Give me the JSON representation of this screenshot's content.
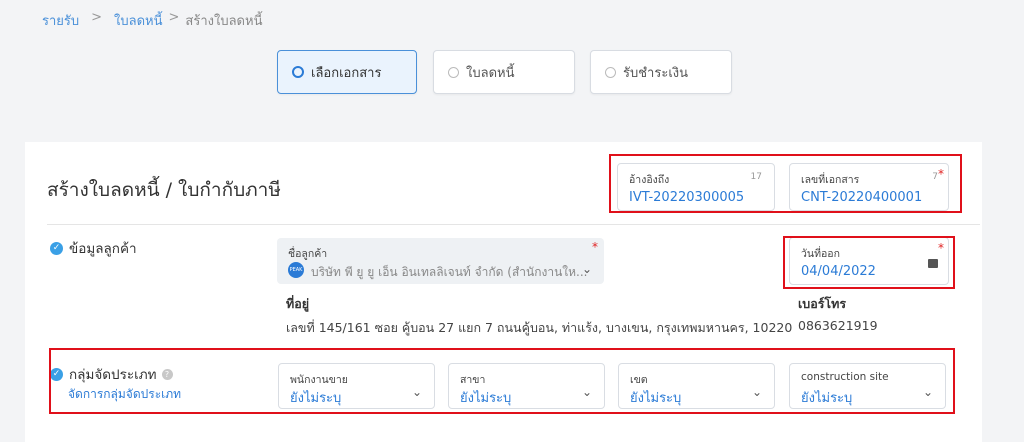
{
  "breadcrumb": {
    "root": "รายรับ",
    "sep1": ">",
    "section": "ใบลดหนี้",
    "sep2": ">",
    "current": "สร้างใบลดหนี้"
  },
  "steps": [
    {
      "label": "เลือกเอกสาร",
      "active": true
    },
    {
      "label": "ใบลดหนี้",
      "active": false
    },
    {
      "label": "รับชำระเงิน",
      "active": false
    }
  ],
  "header": {
    "title": "สร้างใบลดหนี้ / ใบกำกับภาษี"
  },
  "reference": {
    "label": "อ้างอิงถึง",
    "value": "IVT-20220300005",
    "count": "17"
  },
  "doc_number": {
    "label": "เลขที่เอกสาร",
    "value": "CNT-20220400001",
    "count": "7",
    "required": "*"
  },
  "customer_section": {
    "label": "ข้อมูลลูกค้า"
  },
  "customer": {
    "label": "ชื่อลูกค้า",
    "required": "*",
    "avatar_text": "PEAK",
    "value": "บริษัท พี ยู ยู เอ็น อินเทลลิเจนท์ จำกัด (สำนักงานให...",
    "address_label": "ที่อยู่",
    "address": "เลขที่ 145/161 ซอย คู้บอน 27 แยก 7 ถนนคู้บอน, ท่าแร้ง, บางเขน, กรุงเทพมหานคร, 10220",
    "phone_label": "เบอร์โทร",
    "phone": "0863621919"
  },
  "issue_date": {
    "label": "วันที่ออก",
    "value": "04/04/2022",
    "required": "*"
  },
  "category_section": {
    "label": "กลุ่มจัดประเภท",
    "help": "?",
    "manage_link": "จัดการกลุ่มจัดประเภท"
  },
  "category_fields": [
    {
      "label": "พนักงานขาย",
      "value": "ยังไม่ระบุ"
    },
    {
      "label": "สาขา",
      "value": "ยังไม่ระบุ"
    },
    {
      "label": "เขต",
      "value": "ยังไม่ระบุ"
    },
    {
      "label": "construction site",
      "value": "ยังไม่ระบุ"
    }
  ],
  "icons": {
    "chevron": "chevron-down-icon",
    "calendar": "calendar-icon",
    "check": "check-circle-icon",
    "help": "help-circle-icon"
  },
  "colors": {
    "accent": "#2b7bd6",
    "highlight_box": "#e0101a",
    "check": "#3aa0e6"
  }
}
